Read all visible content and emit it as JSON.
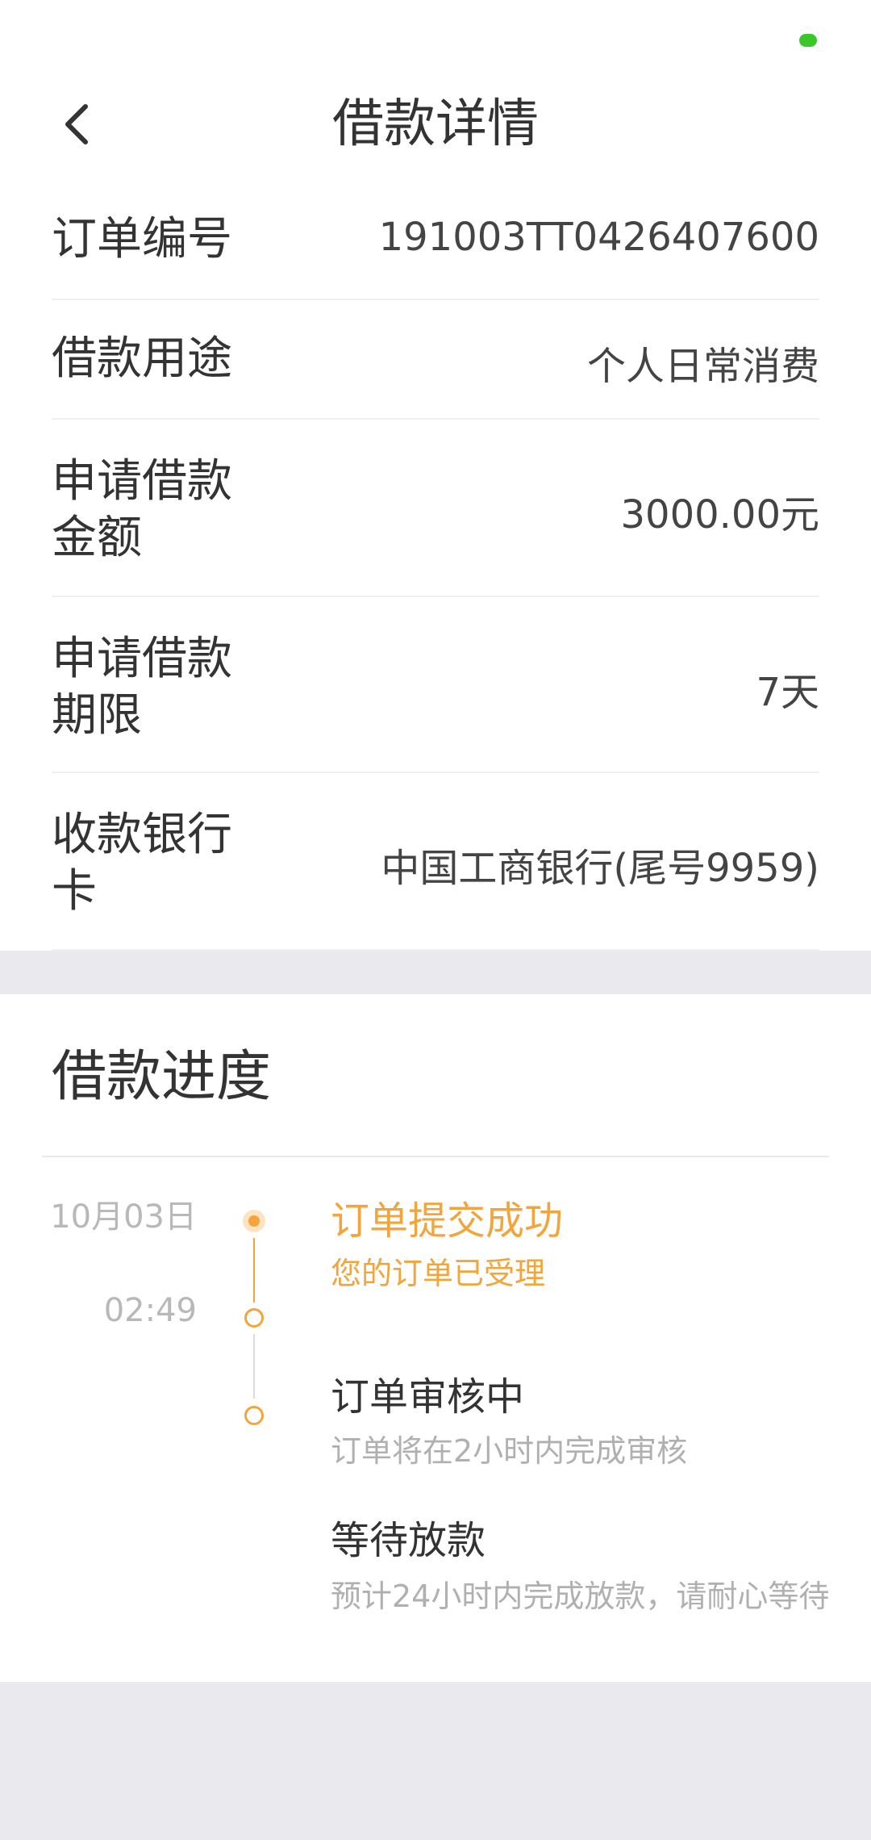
{
  "header": {
    "title": "借款详情"
  },
  "details": {
    "order_no": {
      "label": "订单编号",
      "value": "191003TT0426407600"
    },
    "purpose": {
      "label": "借款用途",
      "value": "个人日常消费"
    },
    "amount": {
      "label": "申请借款金额",
      "value": "3000.00元"
    },
    "term": {
      "label": "申请借款期限",
      "value": "7天"
    },
    "bank_card": {
      "label": "收款银行卡",
      "value": "中国工商银行(尾号9959)"
    }
  },
  "progress": {
    "title": "借款进度",
    "date": "10月03日",
    "time": "02:49",
    "steps": [
      {
        "title": "订单提交成功",
        "desc": "您的订单已受理",
        "state": "done"
      },
      {
        "title": "订单审核中",
        "desc": "订单将在2小时内完成审核",
        "state": "pending"
      },
      {
        "title": "等待放款",
        "desc": "预计24小时内完成放款，请耐心等待",
        "state": "pending"
      }
    ]
  },
  "colors": {
    "accent": "#f3a53c",
    "status_green": "#3bc72a",
    "background": "#e9e9ee"
  },
  "icons": {
    "back": "chevron-left-icon"
  }
}
